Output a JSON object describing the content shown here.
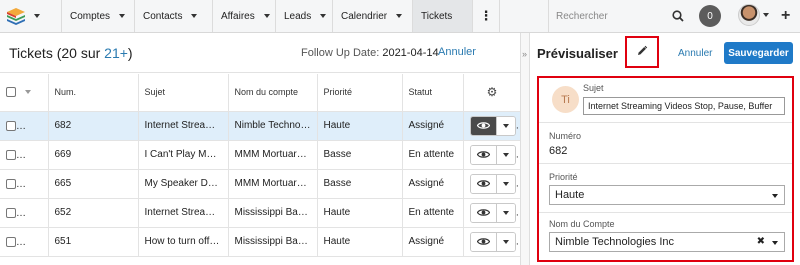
{
  "nav": {
    "items": [
      "Comptes",
      "Contacts",
      "Affaires",
      "Leads",
      "Calendrier",
      "Tickets"
    ],
    "active": "Tickets",
    "search_placeholder": "Rechercher",
    "notification_count": "0"
  },
  "list": {
    "title_prefix": "Tickets (20 sur ",
    "title_link": "21+",
    "title_suffix": ")",
    "filter_label": "Follow Up Date:",
    "filter_value": "2021-04-14",
    "cancel_label": "Annuler",
    "columns": [
      "Num.",
      "Sujet",
      "Nom du compte",
      "Priorité",
      "Statut"
    ],
    "rows": [
      {
        "num": "682",
        "subject": "Internet Streaming Videos Stop, Pause, Buffer",
        "account": "Nimble Technologies Inc",
        "priority": "Haute",
        "status": "Assigné",
        "selected": true
      },
      {
        "num": "669",
        "subject": "I Can't Play Music",
        "account": "MMM Mortuary Services",
        "priority": "Basse",
        "status": "En attente",
        "selected": false
      },
      {
        "num": "665",
        "subject": "My Speaker Doesn't Work",
        "account": "MMM Mortuary Services",
        "priority": "Basse",
        "status": "Assigné",
        "selected": false
      },
      {
        "num": "652",
        "subject": "Internet Streaming Videos",
        "account": "Mississippi Bank Group",
        "priority": "Haute",
        "status": "En attente",
        "selected": false
      },
      {
        "num": "651",
        "subject": "How to turn off sound",
        "account": "Mississippi Bank Group",
        "priority": "Haute",
        "status": "Assigné",
        "selected": false
      }
    ]
  },
  "preview": {
    "title": "Prévisualiser",
    "cancel_label": "Annuler",
    "save_label": "Sauvegarder",
    "avatar_initials": "Ti",
    "subject_label": "Sujet",
    "subject_value": "Internet Streaming Videos Stop, Pause, Buffer",
    "number_label": "Numéro",
    "number_value": "682",
    "priority_label": "Priorité",
    "priority_value": "Haute",
    "account_label": "Nom du Compte",
    "account_value": "Nimble Technologies Inc"
  },
  "colors": {
    "accent": "#1f7ac8",
    "link": "#2a7ab0",
    "highlight_border": "#e0000f",
    "selected_row": "#dfeefa"
  },
  "icons": [
    "app-logo-icon",
    "search-icon",
    "plus-icon",
    "star-icon",
    "gear-icon",
    "eye-icon",
    "pencil-icon",
    "clear-icon",
    "chevron-down-icon"
  ]
}
